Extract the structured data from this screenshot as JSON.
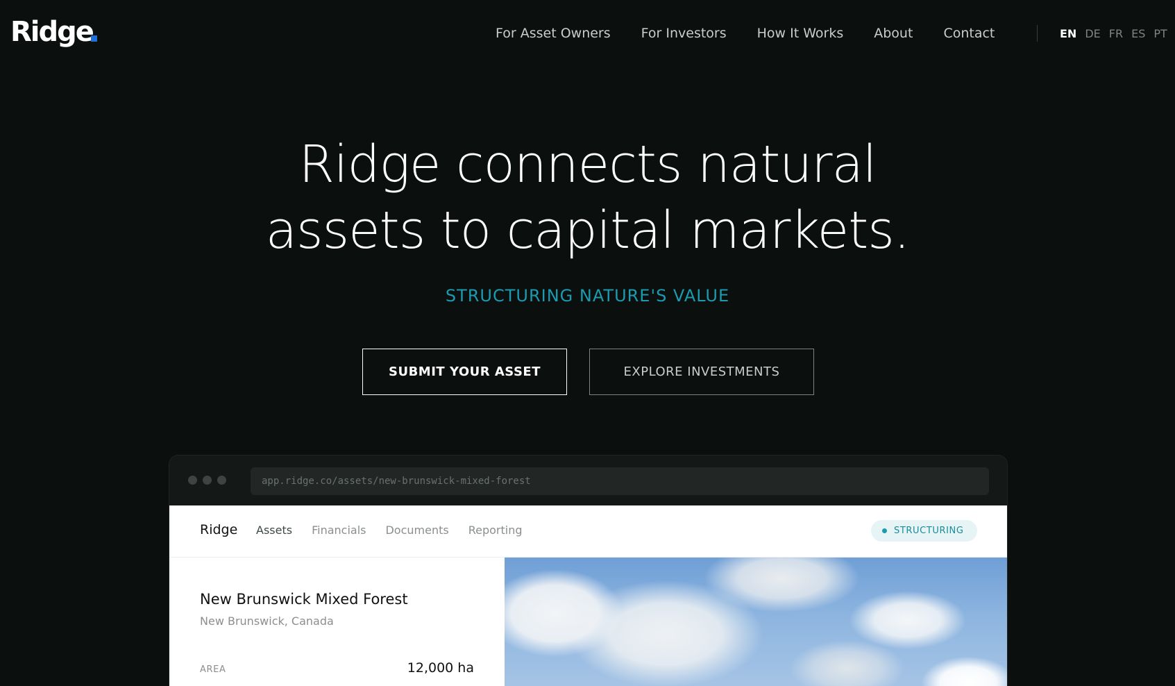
{
  "header": {
    "logo": "Ridge",
    "nav": [
      "For Asset Owners",
      "For Investors",
      "How It Works",
      "About",
      "Contact"
    ],
    "languages": [
      "EN",
      "DE",
      "FR",
      "ES",
      "PT"
    ],
    "active_language": "EN"
  },
  "hero": {
    "title": "Ridge connects natural assets to capital markets.",
    "subtitle": "STRUCTURING NATURE'S VALUE",
    "primary_button": "SUBMIT YOUR ASSET",
    "secondary_button": "EXPLORE INVESTMENTS"
  },
  "browser": {
    "url": "app.ridge.co/assets/new-brunswick-mixed-forest"
  },
  "app": {
    "brand": "Ridge",
    "tabs": [
      "Assets",
      "Financials",
      "Documents",
      "Reporting"
    ],
    "active_tab": "Assets",
    "status": "STRUCTURING"
  },
  "asset": {
    "name": "New Brunswick Mixed Forest",
    "location": "New Brunswick, Canada",
    "area_label": "AREA",
    "area_value": "12,000 ha"
  },
  "colors": {
    "background": "#0b0f0e",
    "accent": "#1b9bb0",
    "logo_dot": "#1e6fd9"
  }
}
